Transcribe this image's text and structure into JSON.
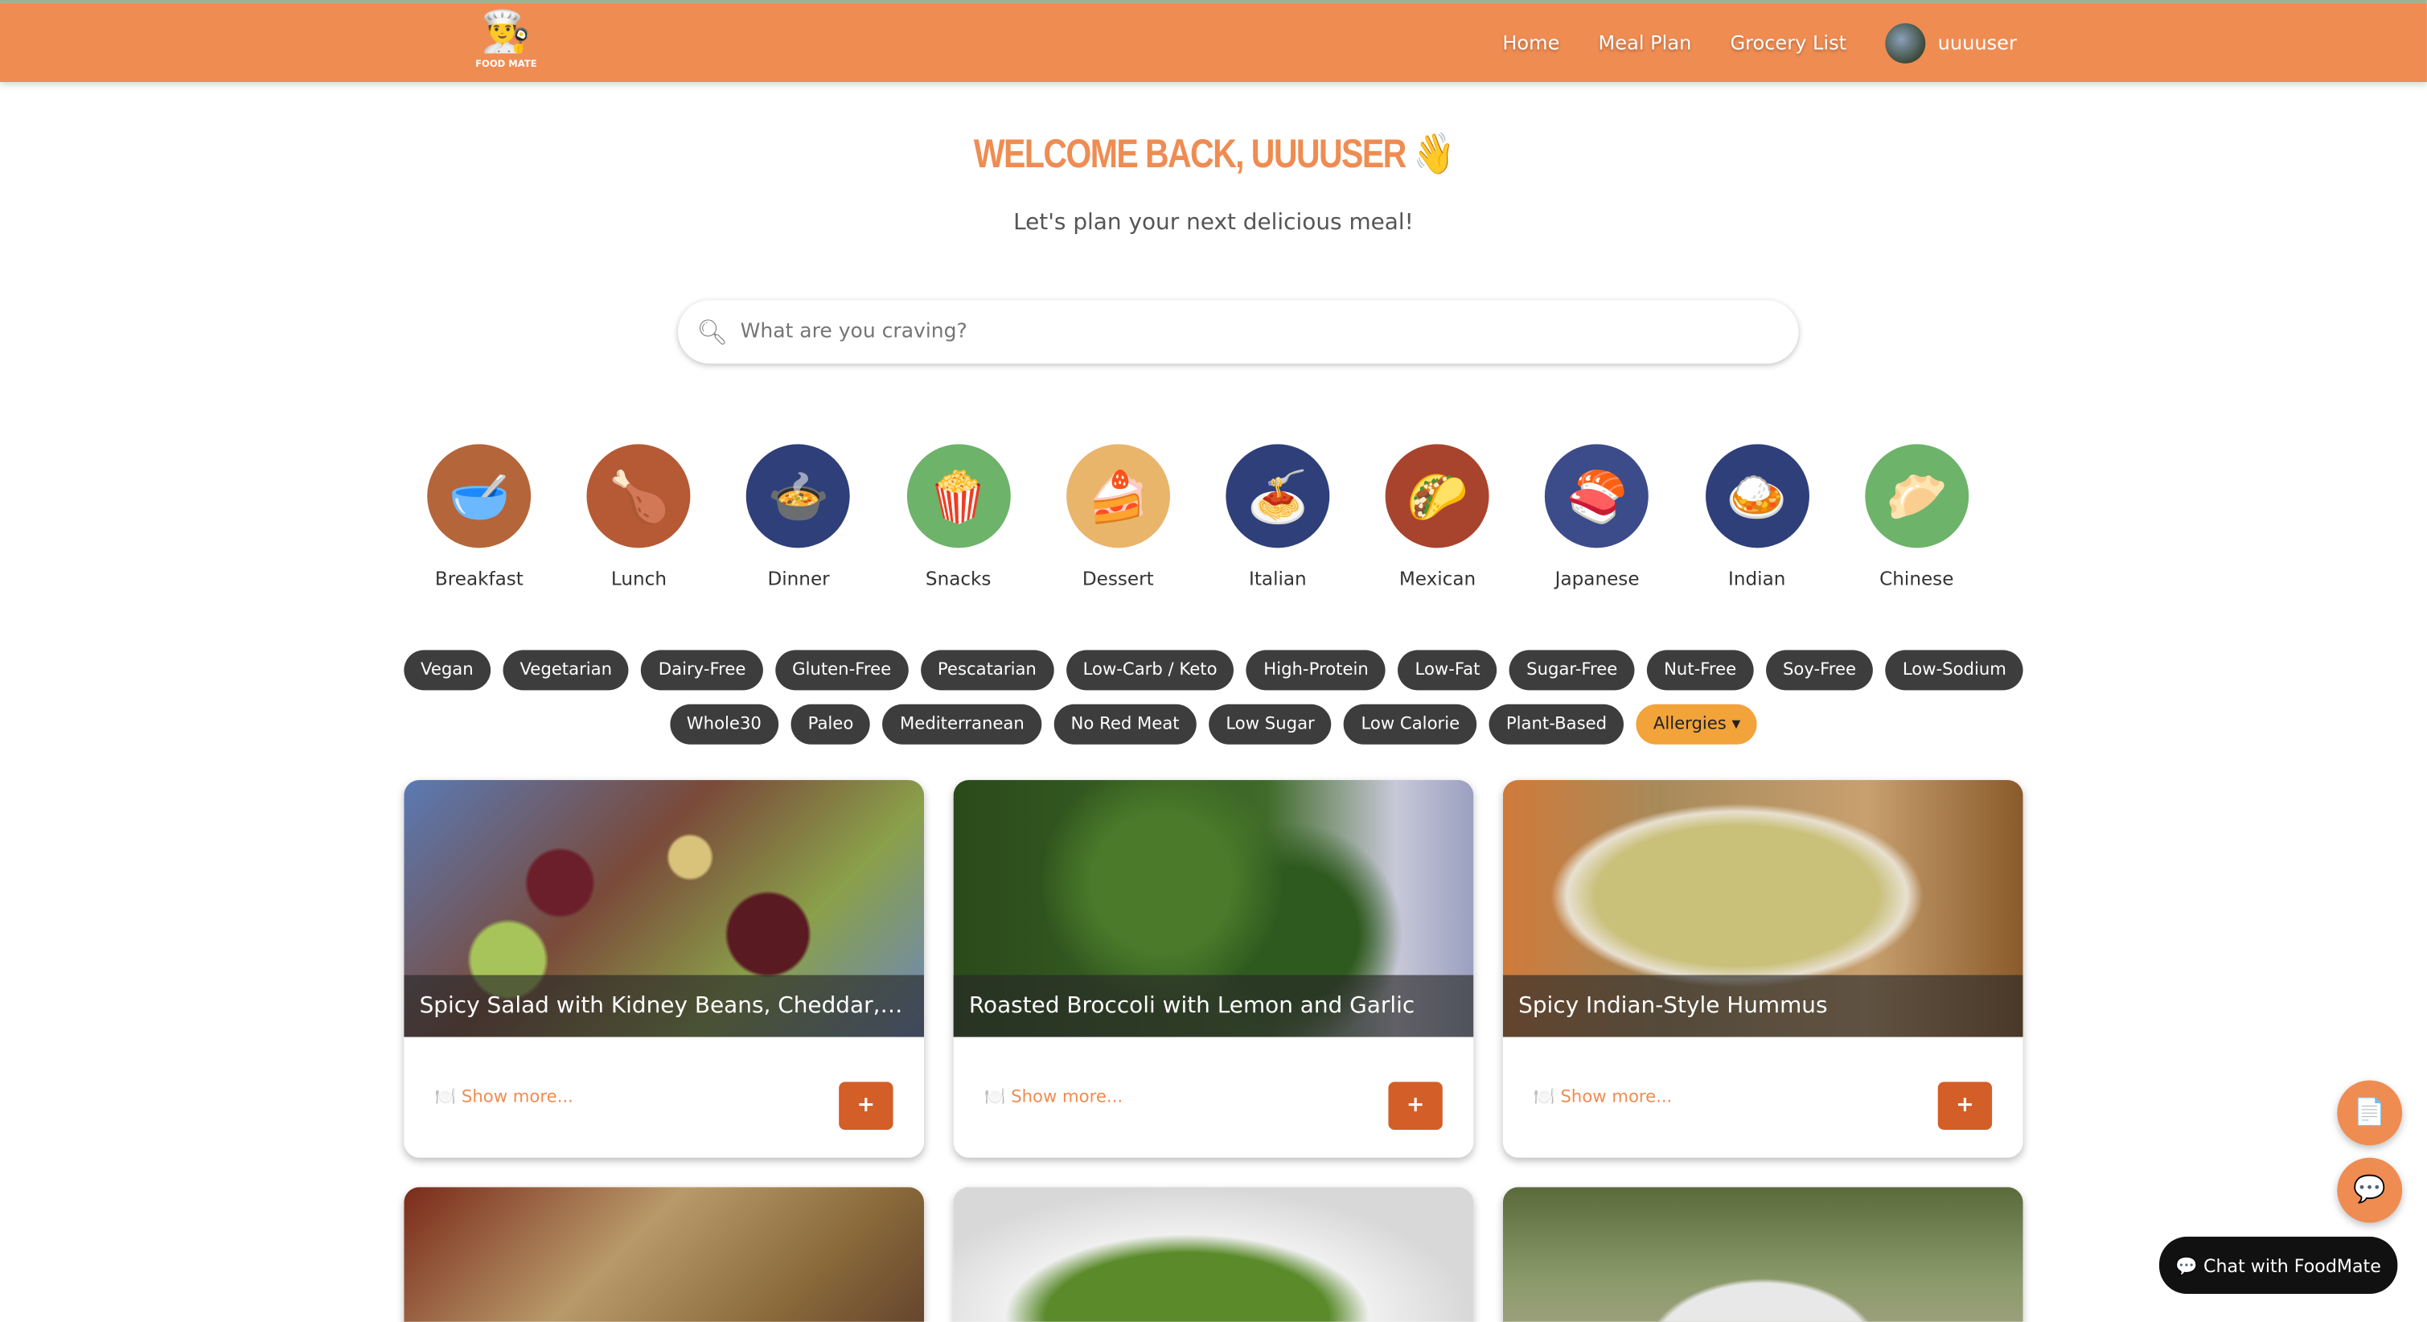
{
  "header": {
    "logo_text": "FOOD MATE",
    "nav": [
      "Home",
      "Meal Plan",
      "Grocery List"
    ],
    "username": "uuuuser"
  },
  "welcome": {
    "title": "WELCOME BACK, UUUUSER 👋",
    "subtitle": "Let's plan your next delicious meal!"
  },
  "search": {
    "placeholder": "What are you craving?",
    "value": ""
  },
  "categories": [
    {
      "label": "Breakfast",
      "emoji": "🥣",
      "color": "#B5653A"
    },
    {
      "label": "Lunch",
      "emoji": "🍗",
      "color": "#B55A34"
    },
    {
      "label": "Dinner",
      "emoji": "🍲",
      "color": "#2E3F7A"
    },
    {
      "label": "Snacks",
      "emoji": "🍿",
      "color": "#6DB36A"
    },
    {
      "label": "Dessert",
      "emoji": "🍰",
      "color": "#E9B56B"
    },
    {
      "label": "Italian",
      "emoji": "🍝",
      "color": "#2E3F7A"
    },
    {
      "label": "Mexican",
      "emoji": "🌮",
      "color": "#A8432E"
    },
    {
      "label": "Japanese",
      "emoji": "🍣",
      "color": "#3C4B8A"
    },
    {
      "label": "Indian",
      "emoji": "🍛",
      "color": "#2E3F7A"
    },
    {
      "label": "Chinese",
      "emoji": "🥟",
      "color": "#6DB36A"
    }
  ],
  "diet_row1": [
    "Vegan",
    "Vegetarian",
    "Dairy-Free",
    "Gluten-Free",
    "Pescatarian",
    "Low-Carb / Keto",
    "High-Protein",
    "Low-Fat",
    "Sugar-Free",
    "Nut-Free",
    "Soy-Free",
    "Low-Sodium"
  ],
  "diet_row2": [
    "Whole30",
    "Paleo",
    "Mediterranean",
    "No Red Meat",
    "Low Sugar",
    "Low Calorie",
    "Plant-Based"
  ],
  "allergies_label": "Allergies ▾",
  "recipes": [
    {
      "title": "Spicy Salad with Kidney Beans, Cheddar, and Nuts",
      "show_more": "🍽️ Show more...",
      "add": "+"
    },
    {
      "title": "Roasted Broccoli with Lemon and Garlic",
      "show_more": "🍽️ Show more...",
      "add": "+"
    },
    {
      "title": "Spicy Indian-Style Hummus",
      "show_more": "🍽️ Show more...",
      "add": "+"
    }
  ],
  "fabs": {
    "notes_icon": "📄",
    "chat_icon": "💬"
  },
  "chat": {
    "label": "💬 Chat with FoodMate"
  }
}
